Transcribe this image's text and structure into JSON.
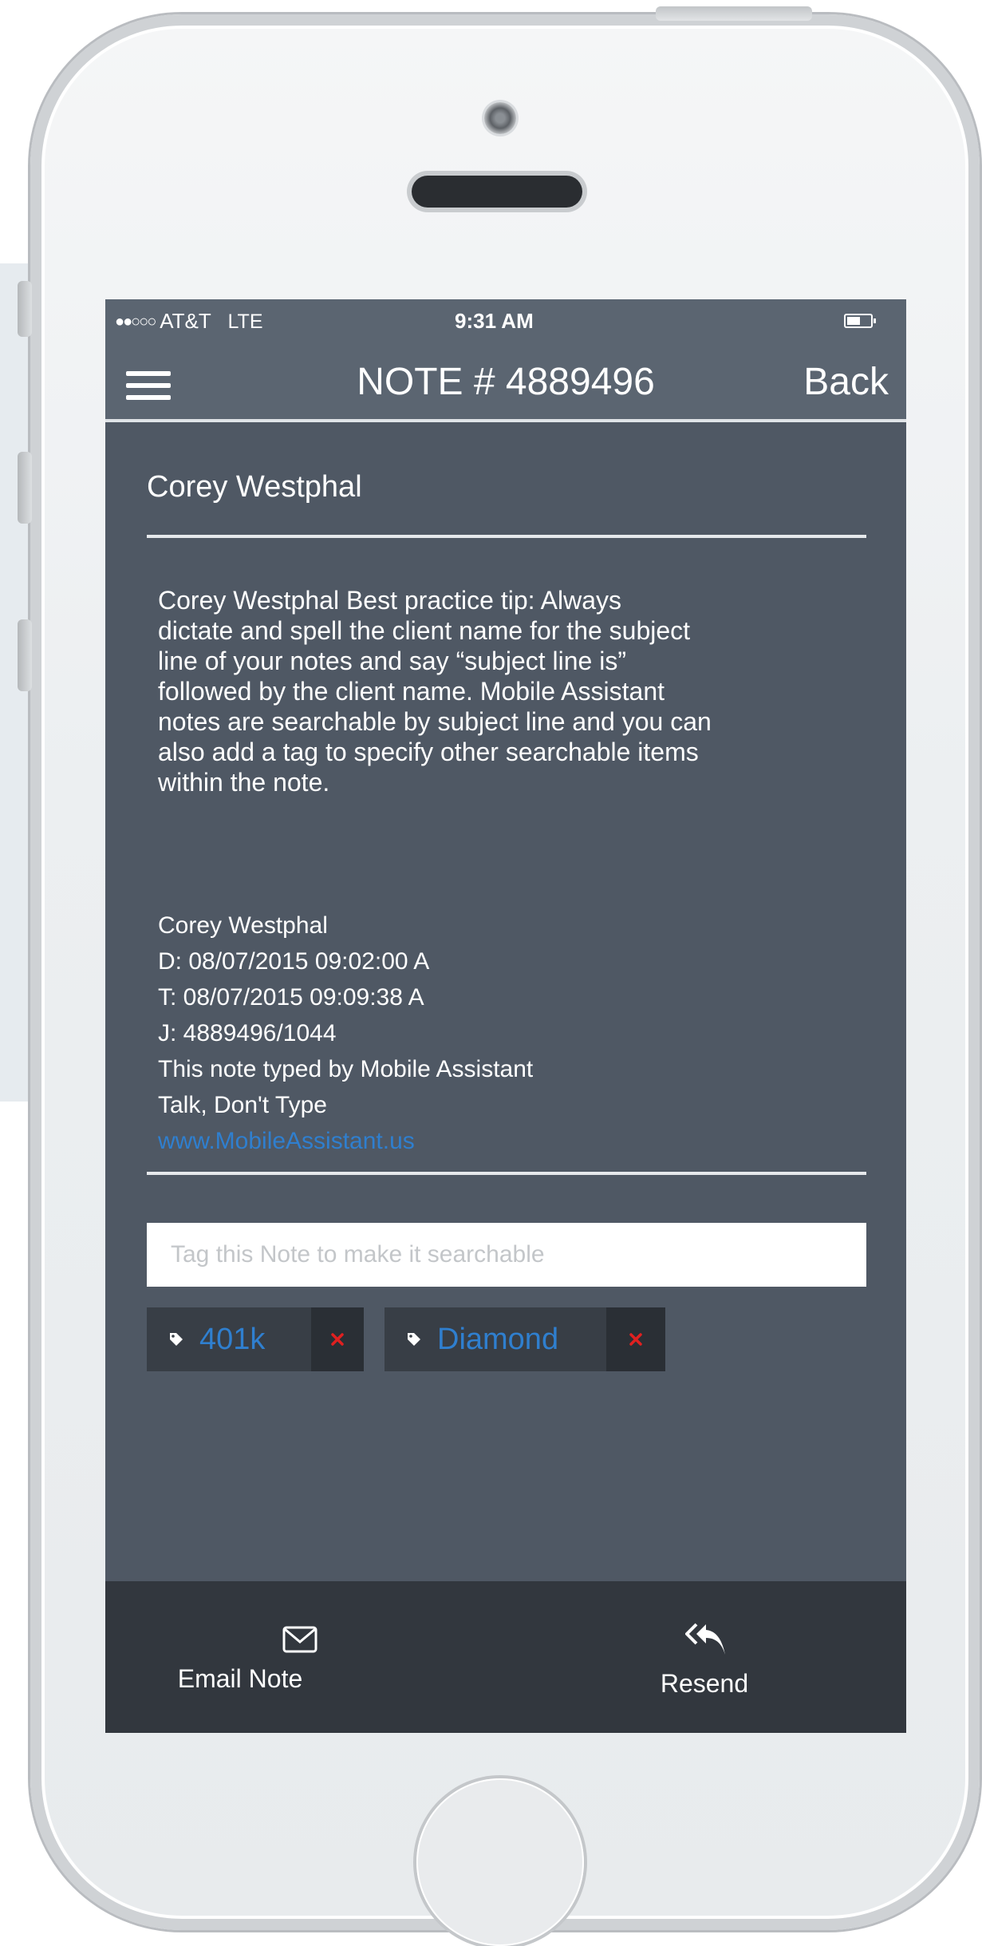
{
  "status_bar": {
    "signal": "●●○○○",
    "carrier": "AT&T",
    "network": "LTE",
    "time": "9:31 AM"
  },
  "nav": {
    "title": "NOTE # 4889496",
    "back_label": "Back"
  },
  "note": {
    "subject": "Corey Westphal",
    "body": "Corey  Westphal  Best practice tip:  Always\ndictate and spell the client name for the subject\nline of your notes and say “subject line is”\nfollowed by the client name.  Mobile Assistant\nnotes are searchable by subject line and you can\nalso add a tag to specify other searchable items\nwithin the note.",
    "signature": {
      "name": "Corey Westphal",
      "dictated": "D: 08/07/2015 09:02:00 A",
      "typed": "T: 08/07/2015 09:09:38 A",
      "job": "J:  4889496/1044",
      "typed_by": "This note typed by Mobile Assistant",
      "slogan": "Talk, Don't Type",
      "link": "www.MobileAssistant.us"
    }
  },
  "tags": {
    "input_placeholder": "Tag this Note to make it searchable",
    "items": [
      {
        "label": "401k"
      },
      {
        "label": "Diamond"
      }
    ]
  },
  "bottom_bar": {
    "email_label": "Email Note",
    "resend_label": "Resend"
  },
  "colors": {
    "screen_bg": "#4f5864",
    "nav_bg": "#5b6571",
    "link": "#2f7fcf",
    "remove_x": "#e02020",
    "bottom_bg": "#32373e"
  }
}
